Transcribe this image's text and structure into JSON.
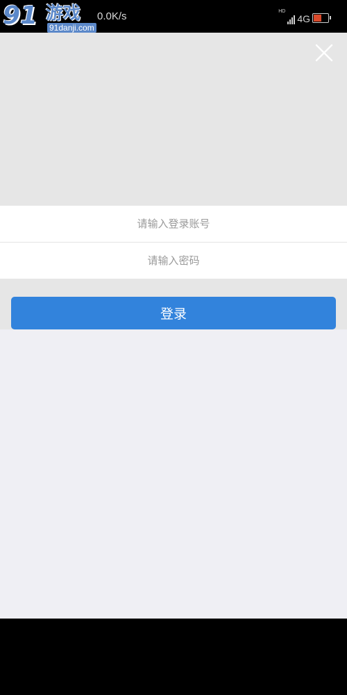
{
  "status_bar": {
    "watermark": {
      "number": "91",
      "title": "游戏",
      "site": "91danji.com"
    },
    "net_speed": "0.0K/s",
    "hd_label": "HD",
    "network_type": "4G",
    "signal_icon": "signal-bars-icon",
    "battery_icon": "battery-icon"
  },
  "login": {
    "close_icon": "close-icon",
    "account_placeholder": "请输入登录账号",
    "password_placeholder": "请输入密码",
    "submit_label": "登录"
  },
  "colors": {
    "accent": "#3283dc",
    "header_bg": "#e6e6e6",
    "page_bg": "#efeff4"
  }
}
